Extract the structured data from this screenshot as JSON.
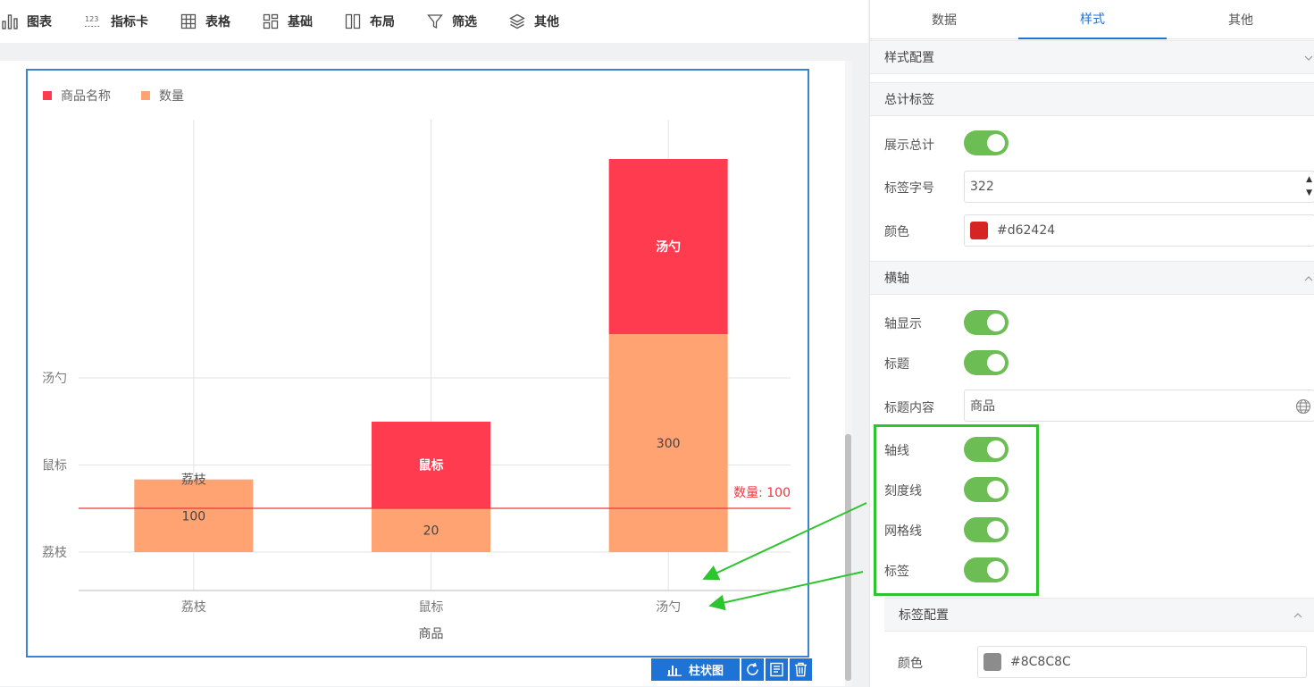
{
  "toolbar": {
    "items": [
      {
        "label": "图表",
        "icon": "bar-chart-icon"
      },
      {
        "label": "指标卡",
        "icon": "number-icon",
        "icon_text": "1̲2̲3"
      },
      {
        "label": "表格",
        "icon": "table-icon"
      },
      {
        "label": "基础",
        "icon": "grid-icon"
      },
      {
        "label": "布局",
        "icon": "layout-icon"
      },
      {
        "label": "筛选",
        "icon": "filter-icon"
      },
      {
        "label": "其他",
        "icon": "layers-icon"
      }
    ]
  },
  "chart_data": {
    "type": "bar",
    "stacked": true,
    "categories": [
      "荔枝",
      "鼠标",
      "汤勺"
    ],
    "xlabel": "商品",
    "y_category_ticks": [
      "荔枝",
      "鼠标",
      "汤勺"
    ],
    "series": [
      {
        "name": "数量",
        "color": "#FFA372",
        "values": [
          100,
          20,
          300
        ],
        "labels": [
          "100",
          "20",
          "300"
        ]
      },
      {
        "name": "商品名称",
        "color": "#FF3B4F",
        "values": [
          0,
          1,
          1
        ],
        "labels": [
          "荔枝",
          "鼠标",
          "汤勺"
        ]
      }
    ],
    "legend": [
      "商品名称",
      "数量"
    ],
    "legend_position": "top-left",
    "grid": true,
    "reference_line": {
      "label": "数量: 100",
      "value": 100,
      "color": "#e8383d"
    }
  },
  "chart_actions": {
    "type_label": "柱状图"
  },
  "panel": {
    "tabs": [
      {
        "label": "数据",
        "active": false
      },
      {
        "label": "样式",
        "active": true
      },
      {
        "label": "其他",
        "active": false
      }
    ],
    "style_config": "样式配置",
    "total_label_section": "总计标签",
    "show_total_label": "展示总计",
    "font_size_label": "标签字号",
    "font_size_value": "322",
    "color_label": "颜色",
    "color_value": "#d62424",
    "x_axis_section": "横轴",
    "axis_show_label": "轴显示",
    "title_label": "标题",
    "title_content_label": "标题内容",
    "title_content_value": "商品",
    "axis_line_label": "轴线",
    "tick_line_label": "刻度线",
    "grid_line_label": "网格线",
    "tag_label": "标签",
    "label_config_section": "标签配置",
    "label_color_label": "颜色",
    "label_color_value": "#8C8C8C"
  },
  "colors": {
    "accent": "#1f73d6",
    "toggle_on": "#6cbd54",
    "highlight": "#2ec42e"
  }
}
